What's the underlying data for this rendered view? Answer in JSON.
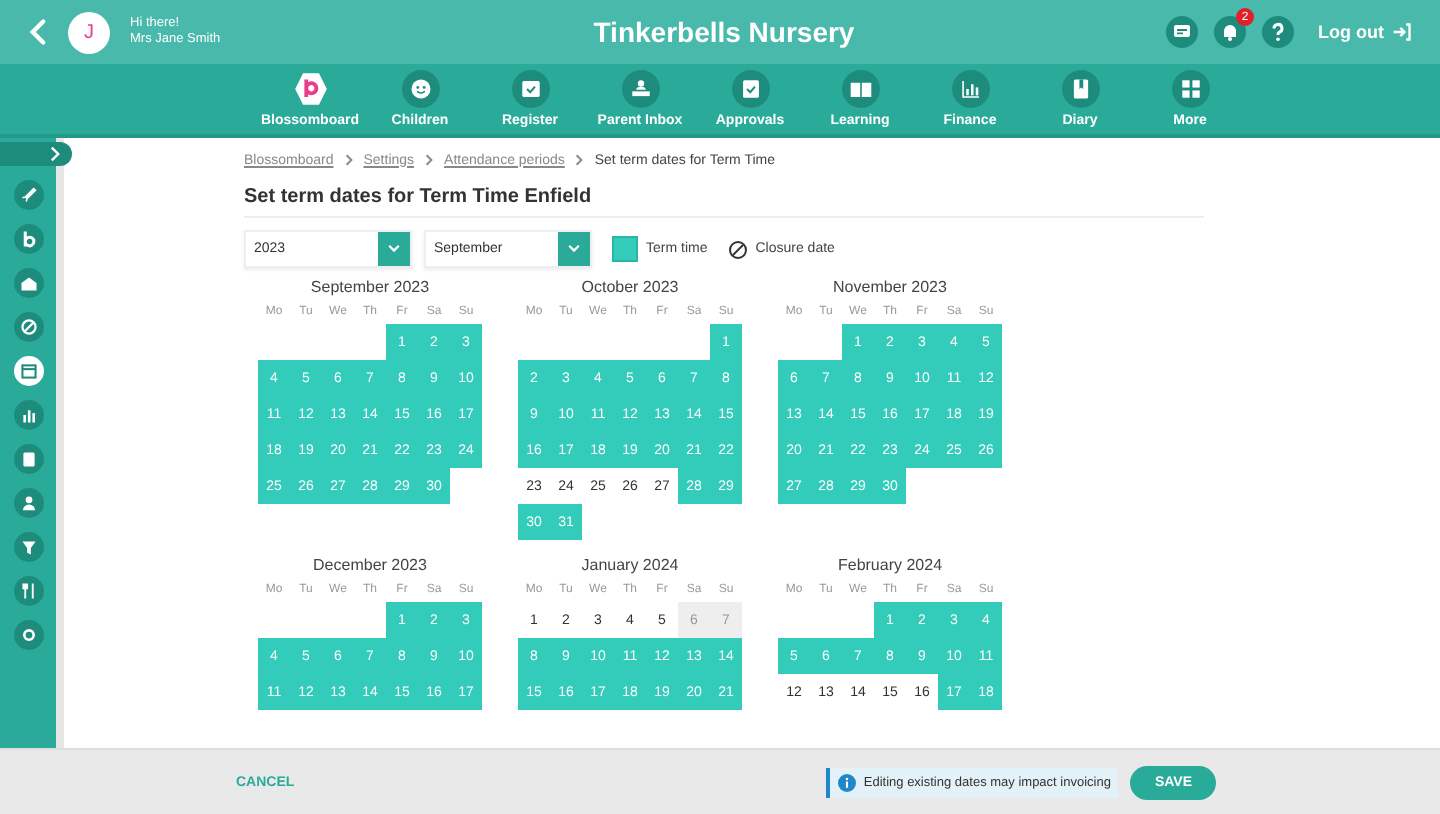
{
  "header": {
    "greeting": "Hi there!",
    "user": "Mrs Jane Smith",
    "avatar_letter": "J",
    "title": "Tinkerbells Nursery",
    "notification_count": "2",
    "logout": "Log out"
  },
  "nav": [
    {
      "label": "Blossomboard",
      "kind": "brand"
    },
    {
      "label": "Children",
      "kind": "icon"
    },
    {
      "label": "Register",
      "kind": "icon"
    },
    {
      "label": "Parent Inbox",
      "kind": "icon"
    },
    {
      "label": "Approvals",
      "kind": "icon"
    },
    {
      "label": "Learning",
      "kind": "icon"
    },
    {
      "label": "Finance",
      "kind": "icon"
    },
    {
      "label": "Diary",
      "kind": "icon"
    },
    {
      "label": "More",
      "kind": "icon"
    }
  ],
  "sidebar": {
    "items": [
      {
        "selected": false
      },
      {
        "selected": false
      },
      {
        "selected": false
      },
      {
        "selected": false
      },
      {
        "selected": true
      },
      {
        "selected": false
      },
      {
        "selected": false
      },
      {
        "selected": false
      },
      {
        "selected": false
      },
      {
        "selected": false
      },
      {
        "selected": false
      }
    ]
  },
  "breadcrumb": [
    {
      "label": "Blossomboard",
      "kind": "link"
    },
    {
      "label": "Settings",
      "kind": "link"
    },
    {
      "label": "Attendance periods",
      "kind": "link"
    },
    {
      "label": "Set term dates for Term Time",
      "kind": "current"
    }
  ],
  "heading": "Set term dates for Term Time Enfield",
  "controls": {
    "year": "2023",
    "month": "September",
    "legend": [
      {
        "label": "Term time",
        "kind": "term"
      },
      {
        "label": "Closure date",
        "kind": "closure"
      }
    ]
  },
  "months": [
    {
      "title": "September 2023",
      "weekdays": [
        "Mo",
        "Tu",
        "We",
        "Th",
        "Fr",
        "Sa",
        "Su"
      ],
      "weeks": [
        [
          {
            "kind": "blank"
          },
          {
            "kind": "blank"
          },
          {
            "kind": "blank"
          },
          {
            "kind": "blank"
          },
          {
            "day": "1",
            "kind": "term"
          },
          {
            "day": "2",
            "kind": "term"
          },
          {
            "day": "3",
            "kind": "term"
          }
        ],
        [
          {
            "day": "4",
            "kind": "term"
          },
          {
            "day": "5",
            "kind": "term"
          },
          {
            "day": "6",
            "kind": "term"
          },
          {
            "day": "7",
            "kind": "term"
          },
          {
            "day": "8",
            "kind": "term"
          },
          {
            "day": "9",
            "kind": "term"
          },
          {
            "day": "10",
            "kind": "term"
          }
        ],
        [
          {
            "day": "11",
            "kind": "term"
          },
          {
            "day": "12",
            "kind": "term"
          },
          {
            "day": "13",
            "kind": "term"
          },
          {
            "day": "14",
            "kind": "term"
          },
          {
            "day": "15",
            "kind": "term"
          },
          {
            "day": "16",
            "kind": "term"
          },
          {
            "day": "17",
            "kind": "term"
          }
        ],
        [
          {
            "day": "18",
            "kind": "term"
          },
          {
            "day": "19",
            "kind": "term"
          },
          {
            "day": "20",
            "kind": "term"
          },
          {
            "day": "21",
            "kind": "term"
          },
          {
            "day": "22",
            "kind": "term"
          },
          {
            "day": "23",
            "kind": "term"
          },
          {
            "day": "24",
            "kind": "term"
          }
        ],
        [
          {
            "day": "25",
            "kind": "term"
          },
          {
            "day": "26",
            "kind": "term"
          },
          {
            "day": "27",
            "kind": "term"
          },
          {
            "day": "28",
            "kind": "term"
          },
          {
            "day": "29",
            "kind": "term"
          },
          {
            "day": "30",
            "kind": "term"
          },
          {
            "kind": "blank"
          }
        ]
      ]
    },
    {
      "title": "October 2023",
      "weekdays": [
        "Mo",
        "Tu",
        "We",
        "Th",
        "Fr",
        "Sa",
        "Su"
      ],
      "weeks": [
        [
          {
            "kind": "blank"
          },
          {
            "kind": "blank"
          },
          {
            "kind": "blank"
          },
          {
            "kind": "blank"
          },
          {
            "kind": "blank"
          },
          {
            "kind": "blank"
          },
          {
            "day": "1",
            "kind": "term"
          }
        ],
        [
          {
            "day": "2",
            "kind": "term"
          },
          {
            "day": "3",
            "kind": "term"
          },
          {
            "day": "4",
            "kind": "term"
          },
          {
            "day": "5",
            "kind": "term"
          },
          {
            "day": "6",
            "kind": "term"
          },
          {
            "day": "7",
            "kind": "term"
          },
          {
            "day": "8",
            "kind": "term"
          }
        ],
        [
          {
            "day": "9",
            "kind": "term"
          },
          {
            "day": "10",
            "kind": "term"
          },
          {
            "day": "11",
            "kind": "term"
          },
          {
            "day": "12",
            "kind": "term"
          },
          {
            "day": "13",
            "kind": "term"
          },
          {
            "day": "14",
            "kind": "term"
          },
          {
            "day": "15",
            "kind": "term"
          }
        ],
        [
          {
            "day": "16",
            "kind": "term"
          },
          {
            "day": "17",
            "kind": "term"
          },
          {
            "day": "18",
            "kind": "term"
          },
          {
            "day": "19",
            "kind": "term"
          },
          {
            "day": "20",
            "kind": "term"
          },
          {
            "day": "21",
            "kind": "term"
          },
          {
            "day": "22",
            "kind": "term"
          }
        ],
        [
          {
            "day": "23",
            "kind": "plain"
          },
          {
            "day": "24",
            "kind": "plain"
          },
          {
            "day": "25",
            "kind": "plain"
          },
          {
            "day": "26",
            "kind": "plain"
          },
          {
            "day": "27",
            "kind": "plain"
          },
          {
            "day": "28",
            "kind": "term"
          },
          {
            "day": "29",
            "kind": "term"
          }
        ],
        [
          {
            "day": "30",
            "kind": "term"
          },
          {
            "day": "31",
            "kind": "term"
          },
          {
            "kind": "blank"
          },
          {
            "kind": "blank"
          },
          {
            "kind": "blank"
          },
          {
            "kind": "blank"
          },
          {
            "kind": "blank"
          }
        ]
      ]
    },
    {
      "title": "November 2023",
      "weekdays": [
        "Mo",
        "Tu",
        "We",
        "Th",
        "Fr",
        "Sa",
        "Su"
      ],
      "weeks": [
        [
          {
            "kind": "blank"
          },
          {
            "kind": "blank"
          },
          {
            "day": "1",
            "kind": "term"
          },
          {
            "day": "2",
            "kind": "term"
          },
          {
            "day": "3",
            "kind": "term"
          },
          {
            "day": "4",
            "kind": "term"
          },
          {
            "day": "5",
            "kind": "term"
          }
        ],
        [
          {
            "day": "6",
            "kind": "term"
          },
          {
            "day": "7",
            "kind": "term"
          },
          {
            "day": "8",
            "kind": "term"
          },
          {
            "day": "9",
            "kind": "term"
          },
          {
            "day": "10",
            "kind": "term"
          },
          {
            "day": "11",
            "kind": "term"
          },
          {
            "day": "12",
            "kind": "term"
          }
        ],
        [
          {
            "day": "13",
            "kind": "term"
          },
          {
            "day": "14",
            "kind": "term"
          },
          {
            "day": "15",
            "kind": "term"
          },
          {
            "day": "16",
            "kind": "term"
          },
          {
            "day": "17",
            "kind": "term"
          },
          {
            "day": "18",
            "kind": "term"
          },
          {
            "day": "19",
            "kind": "term"
          }
        ],
        [
          {
            "day": "20",
            "kind": "term"
          },
          {
            "day": "21",
            "kind": "term"
          },
          {
            "day": "22",
            "kind": "term"
          },
          {
            "day": "23",
            "kind": "term"
          },
          {
            "day": "24",
            "kind": "term"
          },
          {
            "day": "25",
            "kind": "term"
          },
          {
            "day": "26",
            "kind": "term"
          }
        ],
        [
          {
            "day": "27",
            "kind": "term"
          },
          {
            "day": "28",
            "kind": "term"
          },
          {
            "day": "29",
            "kind": "term"
          },
          {
            "day": "30",
            "kind": "term"
          },
          {
            "kind": "blank"
          },
          {
            "kind": "blank"
          },
          {
            "kind": "blank"
          }
        ]
      ]
    },
    {
      "title": "December 2023",
      "weekdays": [
        "Mo",
        "Tu",
        "We",
        "Th",
        "Fr",
        "Sa",
        "Su"
      ],
      "weeks": [
        [
          {
            "kind": "blank"
          },
          {
            "kind": "blank"
          },
          {
            "kind": "blank"
          },
          {
            "kind": "blank"
          },
          {
            "day": "1",
            "kind": "term"
          },
          {
            "day": "2",
            "kind": "term"
          },
          {
            "day": "3",
            "kind": "term"
          }
        ],
        [
          {
            "day": "4",
            "kind": "term"
          },
          {
            "day": "5",
            "kind": "term"
          },
          {
            "day": "6",
            "kind": "term"
          },
          {
            "day": "7",
            "kind": "term"
          },
          {
            "day": "8",
            "kind": "term"
          },
          {
            "day": "9",
            "kind": "term"
          },
          {
            "day": "10",
            "kind": "term"
          }
        ],
        [
          {
            "day": "11",
            "kind": "term"
          },
          {
            "day": "12",
            "kind": "term"
          },
          {
            "day": "13",
            "kind": "term"
          },
          {
            "day": "14",
            "kind": "term"
          },
          {
            "day": "15",
            "kind": "term"
          },
          {
            "day": "16",
            "kind": "term"
          },
          {
            "day": "17",
            "kind": "term"
          }
        ]
      ]
    },
    {
      "title": "January 2024",
      "weekdays": [
        "Mo",
        "Tu",
        "We",
        "Th",
        "Fr",
        "Sa",
        "Su"
      ],
      "weeks": [
        [
          {
            "day": "1",
            "kind": "plain"
          },
          {
            "day": "2",
            "kind": "plain"
          },
          {
            "day": "3",
            "kind": "plain"
          },
          {
            "day": "4",
            "kind": "plain"
          },
          {
            "day": "5",
            "kind": "plain"
          },
          {
            "day": "6",
            "kind": "grey"
          },
          {
            "day": "7",
            "kind": "grey"
          }
        ],
        [
          {
            "day": "8",
            "kind": "term"
          },
          {
            "day": "9",
            "kind": "term"
          },
          {
            "day": "10",
            "kind": "term"
          },
          {
            "day": "11",
            "kind": "term"
          },
          {
            "day": "12",
            "kind": "term"
          },
          {
            "day": "13",
            "kind": "term"
          },
          {
            "day": "14",
            "kind": "term"
          }
        ],
        [
          {
            "day": "15",
            "kind": "term"
          },
          {
            "day": "16",
            "kind": "term"
          },
          {
            "day": "17",
            "kind": "term"
          },
          {
            "day": "18",
            "kind": "term"
          },
          {
            "day": "19",
            "kind": "term"
          },
          {
            "day": "20",
            "kind": "term"
          },
          {
            "day": "21",
            "kind": "term"
          }
        ]
      ]
    },
    {
      "title": "February 2024",
      "weekdays": [
        "Mo",
        "Tu",
        "We",
        "Th",
        "Fr",
        "Sa",
        "Su"
      ],
      "weeks": [
        [
          {
            "kind": "blank"
          },
          {
            "kind": "blank"
          },
          {
            "kind": "blank"
          },
          {
            "day": "1",
            "kind": "term"
          },
          {
            "day": "2",
            "kind": "term"
          },
          {
            "day": "3",
            "kind": "term"
          },
          {
            "day": "4",
            "kind": "term"
          }
        ],
        [
          {
            "day": "5",
            "kind": "term"
          },
          {
            "day": "6",
            "kind": "term"
          },
          {
            "day": "7",
            "kind": "term"
          },
          {
            "day": "8",
            "kind": "term"
          },
          {
            "day": "9",
            "kind": "term"
          },
          {
            "day": "10",
            "kind": "term"
          },
          {
            "day": "11",
            "kind": "term"
          }
        ],
        [
          {
            "day": "12",
            "kind": "plain"
          },
          {
            "day": "13",
            "kind": "plain"
          },
          {
            "day": "14",
            "kind": "plain"
          },
          {
            "day": "15",
            "kind": "plain"
          },
          {
            "day": "16",
            "kind": "plain"
          },
          {
            "day": "17",
            "kind": "term"
          },
          {
            "day": "18",
            "kind": "term"
          }
        ]
      ]
    }
  ],
  "footer": {
    "cancel": "CANCEL",
    "notice": "Editing existing dates may impact invoicing",
    "save": "SAVE"
  }
}
